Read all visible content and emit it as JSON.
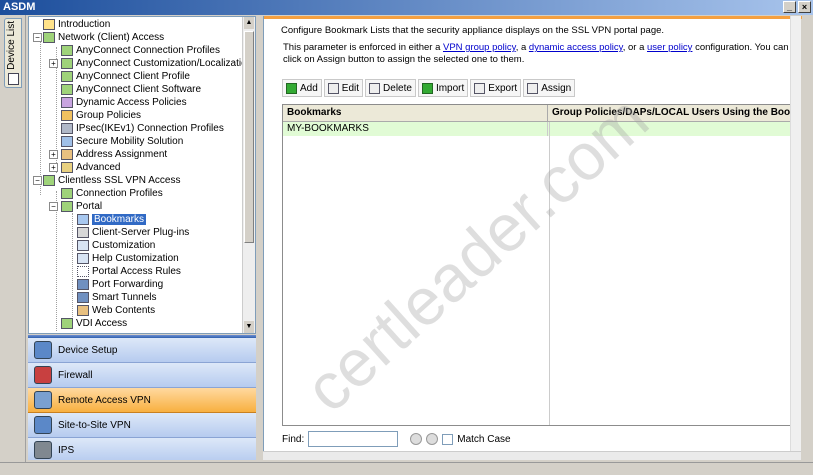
{
  "window": {
    "title": "ASDM",
    "minimize": "_",
    "close": "×"
  },
  "vertical_tab": {
    "label": "Device List"
  },
  "tree": [
    {
      "label": "Introduction"
    },
    {
      "label": "Network (Client) Access"
    },
    {
      "label": "AnyConnect Connection Profiles"
    },
    {
      "label": "AnyConnect Customization/Localization"
    },
    {
      "label": "AnyConnect Client Profile"
    },
    {
      "label": "AnyConnect Client Software"
    },
    {
      "label": "Dynamic Access Policies"
    },
    {
      "label": "Group Policies"
    },
    {
      "label": "IPsec(IKEv1) Connection Profiles"
    },
    {
      "label": "Secure Mobility Solution"
    },
    {
      "label": "Address Assignment"
    },
    {
      "label": "Advanced"
    },
    {
      "label": "Clientless SSL VPN Access"
    },
    {
      "label": "Connection Profiles"
    },
    {
      "label": "Portal"
    },
    {
      "label": "Bookmarks"
    },
    {
      "label": "Client-Server Plug-ins"
    },
    {
      "label": "Customization"
    },
    {
      "label": "Help Customization"
    },
    {
      "label": "Portal Access Rules"
    },
    {
      "label": "Port Forwarding"
    },
    {
      "label": "Smart Tunnels"
    },
    {
      "label": "Web Contents"
    },
    {
      "label": "VDI Access"
    }
  ],
  "nav_buttons": [
    {
      "label": "Device Setup"
    },
    {
      "label": "Firewall"
    },
    {
      "label": "Remote Access VPN"
    },
    {
      "label": "Site-to-Site VPN"
    },
    {
      "label": "IPS"
    }
  ],
  "main": {
    "description": "Configure Bookmark Lists that the security appliance displays on the SSL VPN portal page.",
    "param_prefix": "This parameter is enforced in either a ",
    "link_vpn_group_policy": "VPN group policy",
    "sep1": ", a ",
    "link_dap": "dynamic access policy",
    "sep2": ", or a ",
    "link_user_policy": "user policy",
    "param_suffix": " configuration. You can click on Assign button to assign the selected one to them."
  },
  "toolbar": {
    "add": "Add",
    "edit": "Edit",
    "delete": "Delete",
    "import": "Import",
    "export": "Export",
    "assign": "Assign"
  },
  "table": {
    "columns": [
      "Bookmarks",
      "Group Policies/DAPs/LOCAL Users Using the Bookmark"
    ],
    "rows": [
      {
        "bookmark": "MY-BOOKMARKS",
        "used_by": ""
      }
    ]
  },
  "find": {
    "label": "Find:",
    "value": "",
    "match_case": "Match Case"
  },
  "watermark": "certleader.com",
  "colors": {
    "accent": "#f5a040",
    "selection": "#316ac5",
    "row": "#e1fbd5"
  }
}
